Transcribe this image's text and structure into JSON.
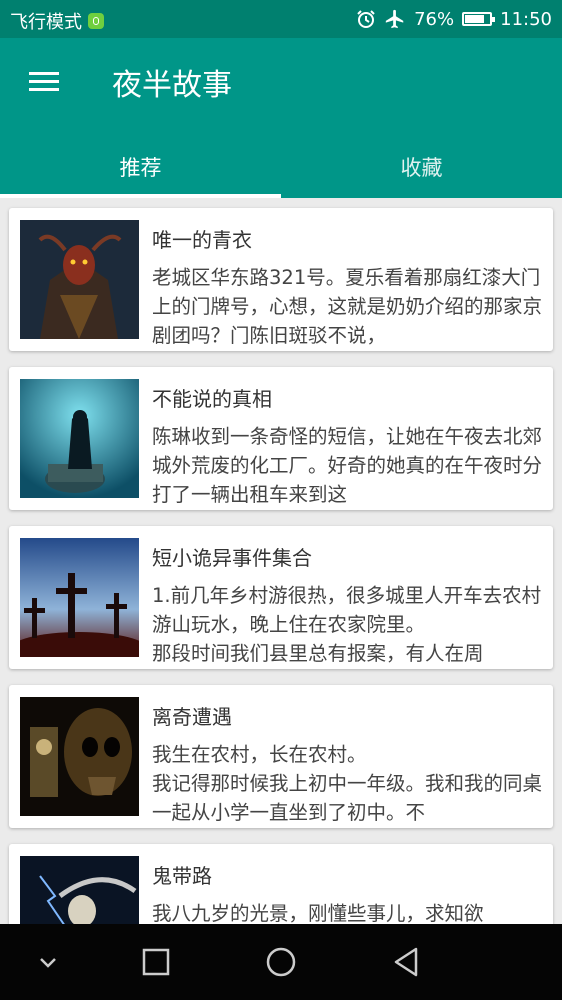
{
  "status_bar": {
    "airplane_mode_label": "飞行模式",
    "battery": "76%",
    "time": "11:50",
    "icons": [
      "app-icon",
      "alarm-icon",
      "airplane-icon",
      "battery-icon"
    ]
  },
  "app_bar": {
    "title": "夜半故事",
    "menu_icon": "hamburger-menu-icon",
    "color": "#009688"
  },
  "tabs": [
    {
      "label": "推荐",
      "active": true
    },
    {
      "label": "收藏",
      "active": false
    }
  ],
  "stories": [
    {
      "title": "唯一的青衣",
      "excerpt": "老城区华东路321号。夏乐看着那扇红漆大门上的门牌号，心想，这就是奶奶介绍的那家京剧团吗？门陈旧斑驳不说，"
    },
    {
      "title": "不能说的真相",
      "excerpt": "陈琳收到一条奇怪的短信，让她在午夜去北郊城外荒废的化工厂。好奇的她真的在午夜时分打了一辆出租车来到这"
    },
    {
      "title": "短小诡异事件集合",
      "excerpt": "1.前几年乡村游很热，很多城里人开车去农村游山玩水，晚上住在农家院里。\n那段时间我们县里总有报案，有人在周"
    },
    {
      "title": "离奇遭遇",
      "excerpt": "我生在农村，长在农村。\n我记得那时候我上初中一年级。我和我的同桌一起从小学一直坐到了初中。不"
    },
    {
      "title": "鬼带路",
      "excerpt": "我八九岁的光景，刚懂些事儿，求知欲"
    }
  ],
  "nav_bar": {
    "buttons": [
      "chevron-down-icon",
      "recents-square-icon",
      "home-circle-icon",
      "back-triangle-icon"
    ]
  }
}
